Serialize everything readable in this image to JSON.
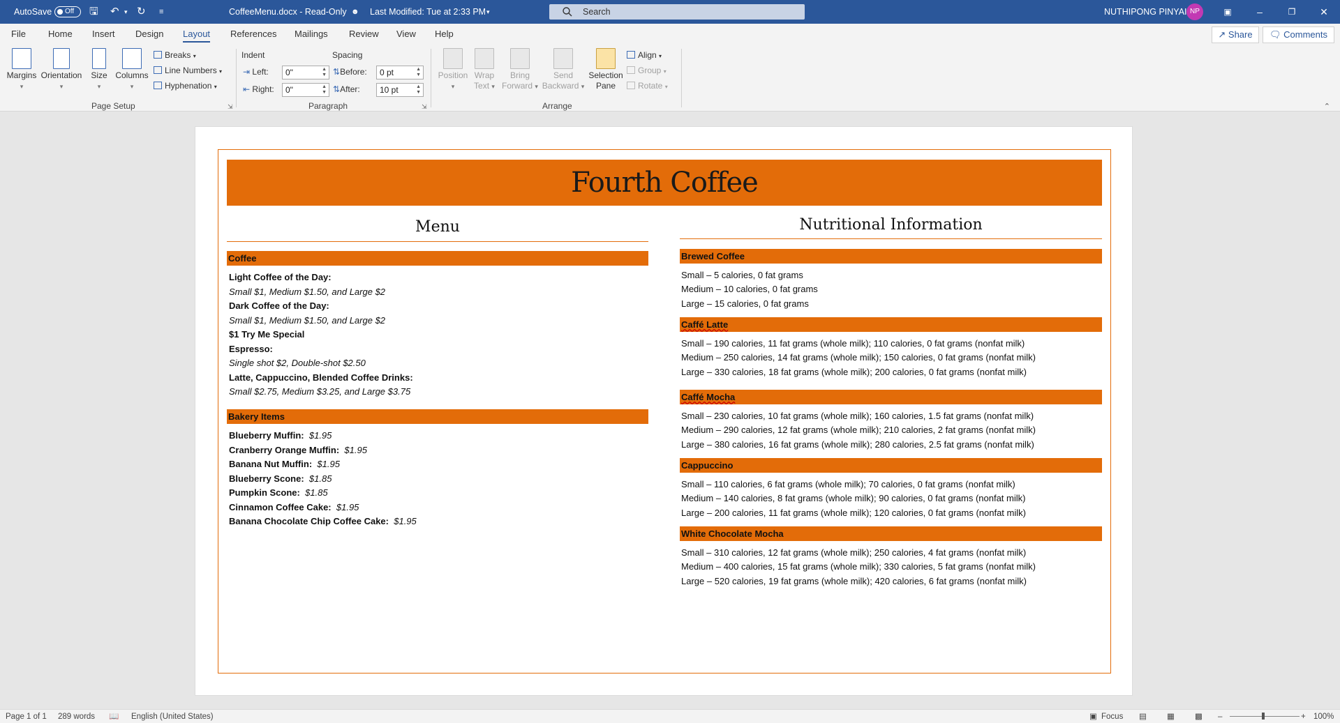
{
  "titlebar": {
    "autosave_label": "AutoSave",
    "autosave_state": "Off",
    "doc_title": "CoffeeMenu.docx  -  Read-Only",
    "last_modified": "Last Modified: Tue at 2:33 PM",
    "search_placeholder": "Search",
    "user_name": "NUTHIPONG PINYAI",
    "user_initials": "NP"
  },
  "tabs": [
    "File",
    "Home",
    "Insert",
    "Design",
    "Layout",
    "References",
    "Mailings",
    "Review",
    "View",
    "Help"
  ],
  "active_tab": "Layout",
  "share_label": "Share",
  "comments_label": "Comments",
  "ribbon": {
    "page_setup": {
      "margins": "Margins",
      "orientation": "Orientation",
      "size": "Size",
      "columns": "Columns",
      "breaks": "Breaks",
      "line_numbers": "Line Numbers",
      "hyphenation": "Hyphenation",
      "group_label": "Page Setup"
    },
    "paragraph": {
      "indent_label": "Indent",
      "spacing_label": "Spacing",
      "left_label": "Left:",
      "left_value": "0\"",
      "right_label": "Right:",
      "right_value": "0\"",
      "before_label": "Before:",
      "before_value": "0 pt",
      "after_label": "After:",
      "after_value": "10 pt",
      "group_label": "Paragraph"
    },
    "arrange": {
      "position": "Position",
      "wrap_text_1": "Wrap",
      "wrap_text_2": "Text",
      "bring_forward_1": "Bring",
      "bring_forward_2": "Forward",
      "send_backward_1": "Send",
      "send_backward_2": "Backward",
      "selection_pane_1": "Selection",
      "selection_pane_2": "Pane",
      "align": "Align",
      "group": "Group",
      "rotate": "Rotate",
      "group_label": "Arrange"
    }
  },
  "document": {
    "title": "Fourth Coffee",
    "menu_heading": "Menu",
    "nutrition_heading": "Nutritional Information",
    "coffee_heading": "Coffee",
    "coffee_lines": [
      {
        "bold": "Light Coffee of the Day:",
        "italic": ""
      },
      {
        "bold": "",
        "italic": "Small $1, Medium $1.50, and Large $2"
      },
      {
        "bold": "Dark Coffee of the Day:",
        "italic": ""
      },
      {
        "bold": "",
        "italic": "Small $1, Medium $1.50, and Large $2"
      },
      {
        "bold": "$1 Try Me Special",
        "italic": ""
      },
      {
        "bold": "Espresso:",
        "italic": ""
      },
      {
        "bold": "",
        "italic": "Single shot $2, Double-shot $2.50"
      },
      {
        "bold": "Latte, Cappuccino, Blended Coffee Drinks:",
        "italic": ""
      },
      {
        "bold": "",
        "italic": "Small $2.75, Medium $3.25, and Large $3.75"
      }
    ],
    "bakery_heading": "Bakery Items",
    "bakery_items": [
      {
        "name": "Blueberry Muffin:",
        "price": "$1.95"
      },
      {
        "name": "Cranberry Orange Muffin:",
        "price": "$1.95"
      },
      {
        "name": "Banana Nut Muffin:",
        "price": "$1.95"
      },
      {
        "name": "Blueberry Scone:",
        "price": "$1.85"
      },
      {
        "name": "Pumpkin Scone:",
        "price": "$1.85"
      },
      {
        "name": "Cinnamon Coffee Cake:",
        "price": "$1.95"
      },
      {
        "name": "Banana Chocolate Chip Coffee Cake:",
        "price": "$1.95"
      }
    ],
    "nutrition_sections": [
      {
        "heading": "Brewed Coffee",
        "lines": [
          "Small – 5 calories, 0 fat grams",
          "Medium – 10 calories, 0 fat grams",
          "Large – 15 calories, 0 fat grams"
        ]
      },
      {
        "heading": "Caffé Latte",
        "lines": [
          "Small – 190 calories, 11 fat grams (whole milk); 110 calories, 0 fat grams (nonfat milk)",
          "Medium – 250 calories, 14 fat grams (whole milk); 150 calories, 0 fat grams (nonfat milk)",
          "Large – 330 calories, 18 fat grams (whole milk); 200 calories, 0 fat grams (nonfat milk)"
        ]
      },
      {
        "heading": "Caffé Mocha",
        "lines": [
          "Small – 230 calories, 10 fat grams (whole milk); 160 calories, 1.5 fat grams (nonfat milk)",
          "Medium – 290 calories, 12 fat grams (whole milk); 210 calories, 2 fat grams (nonfat milk)",
          "Large – 380 calories, 16 fat grams (whole milk); 280 calories, 2.5 fat grams (nonfat milk)"
        ]
      },
      {
        "heading": "Cappuccino",
        "lines": [
          "Small – 110 calories, 6 fat grams (whole milk); 70 calories, 0 fat grams (nonfat milk)",
          "Medium – 140 calories, 8 fat grams (whole milk); 90 calories, 0 fat grams (nonfat milk)",
          "Large – 200 calories, 11 fat grams (whole milk); 120 calories, 0 fat grams (nonfat milk)"
        ]
      },
      {
        "heading": "White Chocolate Mocha",
        "lines": [
          "Small – 310 calories, 12 fat grams (whole milk); 250 calories, 4 fat grams (nonfat milk)",
          "Medium – 400 calories, 15 fat grams (whole milk); 330 calories, 5 fat grams (nonfat milk)",
          "Large – 520 calories, 19 fat grams (whole milk); 420 calories, 6 fat grams (nonfat milk)"
        ]
      }
    ]
  },
  "statusbar": {
    "page": "Page 1 of 1",
    "words": "289 words",
    "language": "English (United States)",
    "focus": "Focus",
    "zoom": "100%"
  },
  "colors": {
    "title_bar": "#2b579a",
    "accent_orange": "#e36c09"
  }
}
